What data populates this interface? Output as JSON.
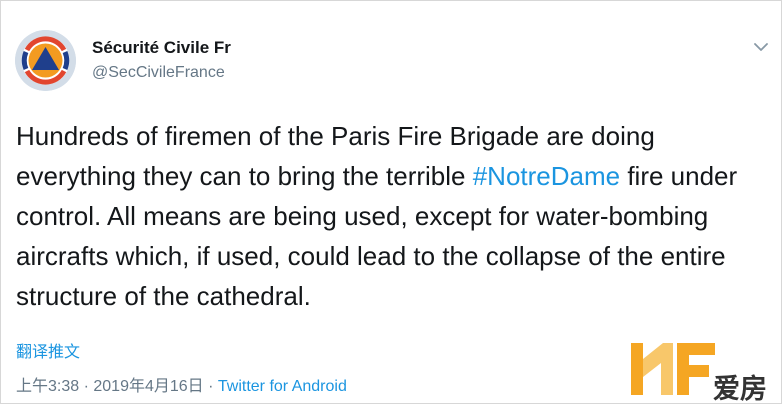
{
  "account": {
    "display_name": "Sécurité Civile Fr",
    "handle": "@SecCivileFrance",
    "avatar_icon": "securite-civile-logo"
  },
  "tweet": {
    "text_before": "Hundreds of firemen of the Paris Fire Brigade are doing everything they can to bring the terrible ",
    "hashtag": "#NotreDame",
    "text_after": " fire under control. All means are being used, except for water-bombing aircrafts which, if used, could lead to the collapse of the entire structure of the cathedral."
  },
  "translate_label": "翻译推文",
  "meta": {
    "time": "上午3:38",
    "separator1": " · ",
    "date": "2019年4月16日",
    "separator2": " · ",
    "source": "Twitter for Android"
  },
  "watermark": {
    "text": "爱房",
    "colors": {
      "orange": "#f5a623",
      "light": "#f8c76a"
    }
  },
  "colors": {
    "link": "#1b95e0",
    "text": "#14171a",
    "muted": "#657786"
  }
}
